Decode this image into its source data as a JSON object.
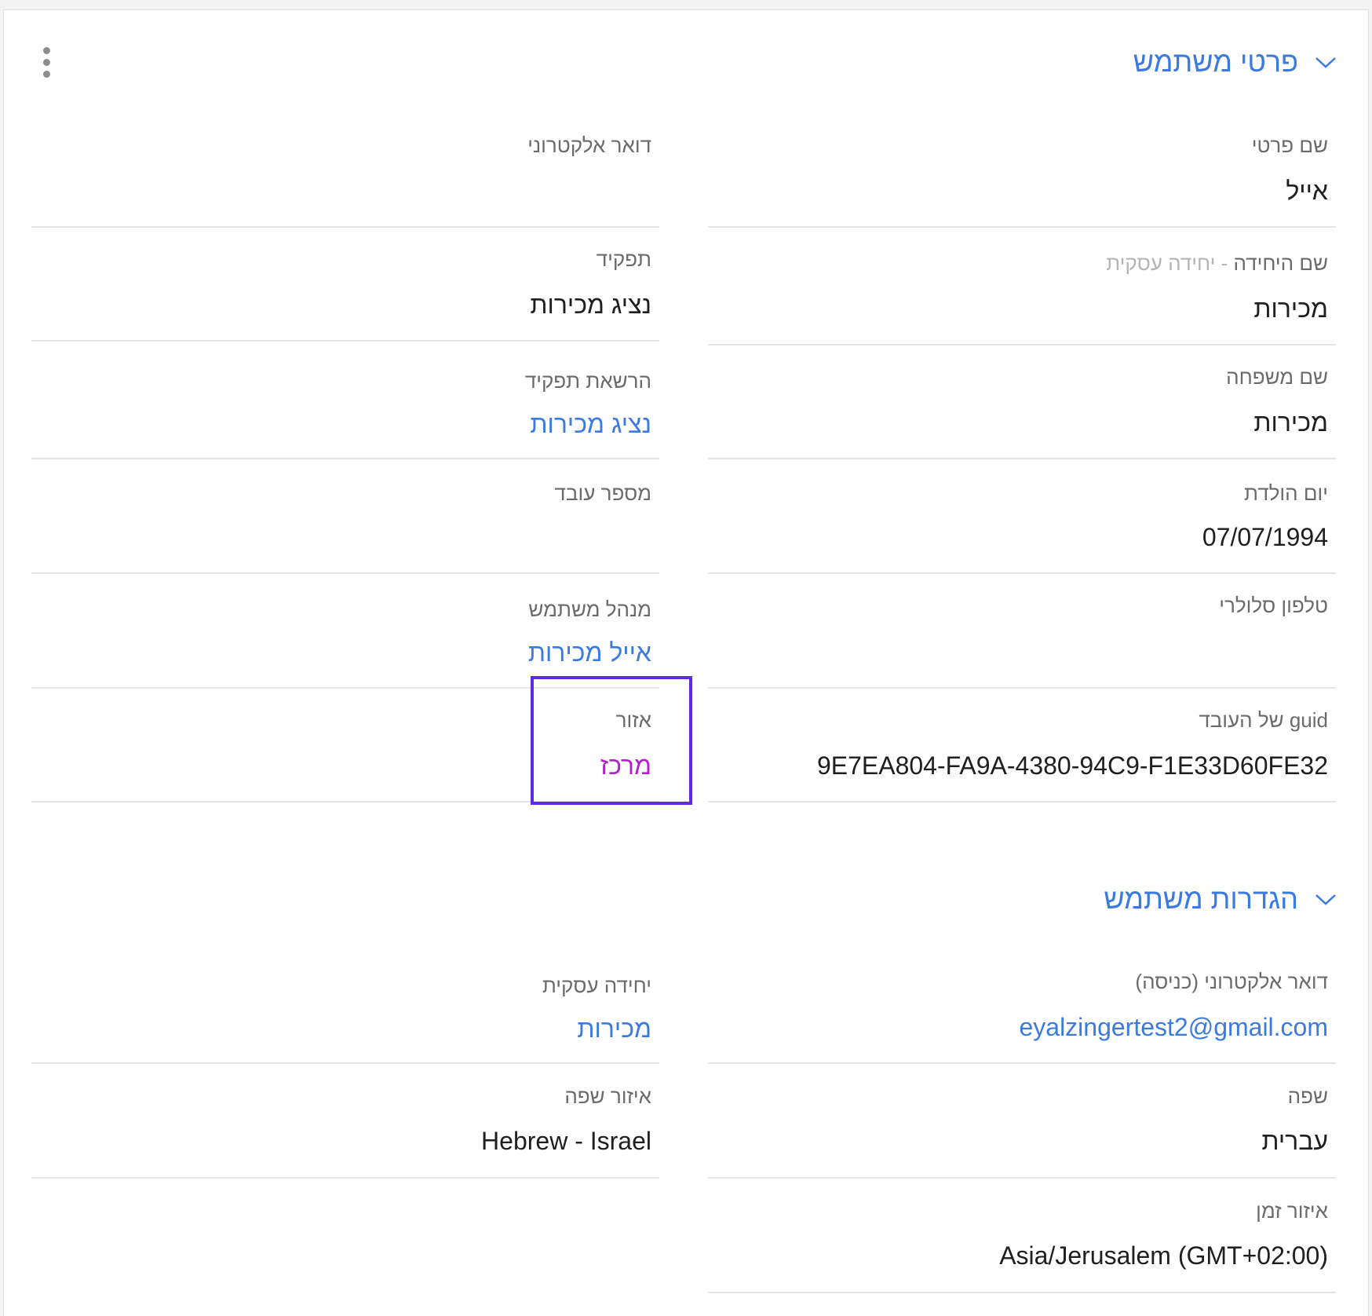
{
  "menu": {
    "icon": "more-vertical-icon"
  },
  "sections": {
    "user_details": {
      "title": "פרטי משתמש",
      "chevron_icon": "chevron-down-icon",
      "fields": {
        "first_name": {
          "label": "שם פרטי",
          "value": "אייל"
        },
        "email": {
          "label": "דואר אלקטרוני",
          "value": ""
        },
        "unit_name": {
          "label": "שם היחידה",
          "label_sub": " - יחידה עסקית",
          "value": "מכירות"
        },
        "role": {
          "label": "תפקיד",
          "value": "נציג מכירות"
        },
        "last_name": {
          "label": "שם משפחה",
          "value": "מכירות"
        },
        "role_permission": {
          "label": "הרשאת תפקיד",
          "value": "נציג מכירות"
        },
        "birthday": {
          "label": "יום הולדת",
          "value": "07/07/1994"
        },
        "employee_number": {
          "label": "מספר עובד",
          "value": ""
        },
        "mobile_phone": {
          "label": "טלפון סלולרי",
          "value": ""
        },
        "user_manager": {
          "label": "מנהל משתמש",
          "value": "אייל מכירות"
        },
        "employee_guid": {
          "label": "guid של העובד",
          "value": "9E7EA804-FA9A-4380-94C9-F1E33D60FE32"
        },
        "region": {
          "label": "אזור",
          "value": "מרכז"
        }
      }
    },
    "user_settings": {
      "title": "הגדרות משתמש",
      "chevron_icon": "chevron-down-icon",
      "fields": {
        "login_email": {
          "label": "דואר אלקטרוני (כניסה)",
          "value": "eyalzingertest2@gmail.com"
        },
        "business_unit": {
          "label": "יחידה עסקית",
          "value": "מכירות"
        },
        "language": {
          "label": "שפה",
          "value": "עברית"
        },
        "language_region": {
          "label": "איזור שפה",
          "value": "Hebrew - Israel"
        },
        "time_zone": {
          "label": "איזור זמן",
          "value": "Asia/Jerusalem (GMT+02:00)"
        }
      }
    }
  },
  "colors": {
    "link": "#3b7be0",
    "region_value": "#b023c9",
    "highlight_border": "#5b2be8"
  }
}
